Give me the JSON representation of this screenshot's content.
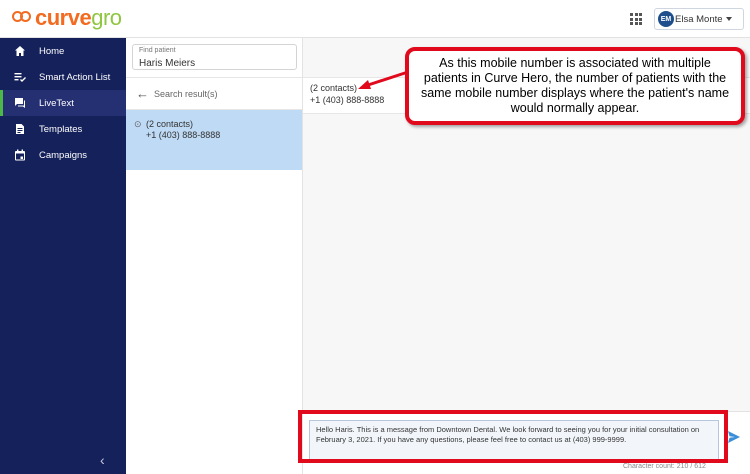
{
  "brand": {
    "name_part1": "curve",
    "name_part2": "gro",
    "color_primary": "#f26b21",
    "color_secondary": "#8fc63f"
  },
  "header": {
    "apps_icon": "grid-icon",
    "user": {
      "initials": "EM",
      "name": "Elsa Monte",
      "avatar_color": "#1e4f8c"
    }
  },
  "sidebar": {
    "bg_color": "#15215a",
    "items": [
      {
        "label": "Home",
        "icon": "home-icon",
        "active": false
      },
      {
        "label": "Smart Action List",
        "icon": "checklist-icon",
        "active": false
      },
      {
        "label": "LiveText",
        "icon": "chat-icon",
        "active": true
      },
      {
        "label": "Templates",
        "icon": "document-icon",
        "active": false
      },
      {
        "label": "Campaigns",
        "icon": "calendar-icon",
        "active": false
      }
    ],
    "collapse_glyph": "‹"
  },
  "patient_panel": {
    "find_label": "Find patient",
    "find_value": "Haris Meiers",
    "search_results_label": "Search result(s)",
    "results": [
      {
        "title": "(2 contacts)",
        "phone": "+1 (403) 888-8888",
        "selected": true,
        "pinned": true
      }
    ]
  },
  "conversation": {
    "header_title": "(2 contacts)",
    "header_phone": "+1 (403) 888-8888",
    "message_text": "Hello Haris. This is a message from Downtown Dental. We look forward to seeing you for your initial consultation on February 3, 2021. If you have any questions, please feel free to contact us at (403) 999-9999.",
    "char_count": "Character count: 210 / 612",
    "send_icon": "send-icon"
  },
  "annotation": {
    "callout_text": "As this mobile number is associated with multiple patients in Curve Hero, the number of patients with the same mobile number displays where the patient's name would normally appear.",
    "color": "#e1091c"
  }
}
